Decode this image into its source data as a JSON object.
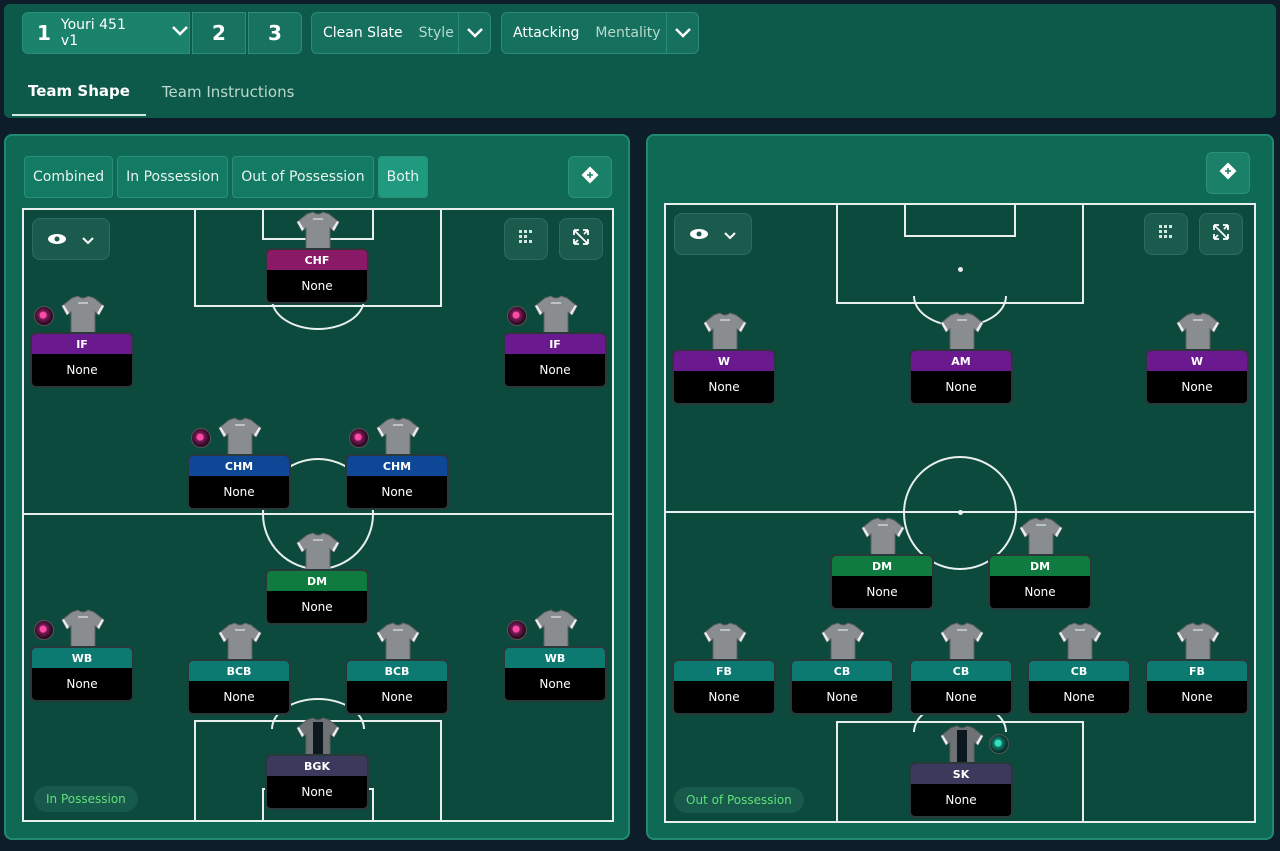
{
  "tactics": {
    "slot1": "1",
    "slot1_name": "Youri 451 v1",
    "slot2": "2",
    "slot3": "3",
    "style_value": "Clean Slate",
    "style_label": "Style",
    "mentality_value": "Attacking",
    "mentality_label": "Mentality"
  },
  "tabs": [
    "Team Shape",
    "Team Instructions"
  ],
  "left": {
    "views": [
      "Combined",
      "In Possession",
      "Out of Possession",
      "Both"
    ],
    "phase_label": "In Possession",
    "players": [
      {
        "role": "CHF",
        "duty": "None",
        "color": "#8a1a68"
      },
      {
        "role": "IF",
        "duty": "None",
        "color": "#6a1a8e"
      },
      {
        "role": "IF",
        "duty": "None",
        "color": "#6a1a8e"
      },
      {
        "role": "CHM",
        "duty": "None",
        "color": "#0e4796"
      },
      {
        "role": "CHM",
        "duty": "None",
        "color": "#0e4796"
      },
      {
        "role": "DM",
        "duty": "None",
        "color": "#0f7b3e"
      },
      {
        "role": "WB",
        "duty": "None",
        "color": "#0d7a72"
      },
      {
        "role": "BCB",
        "duty": "None",
        "color": "#0d7a72"
      },
      {
        "role": "BCB",
        "duty": "None",
        "color": "#0d7a72"
      },
      {
        "role": "WB",
        "duty": "None",
        "color": "#0d7a72"
      },
      {
        "role": "BGK",
        "duty": "None",
        "color": "#3b3a5c"
      }
    ]
  },
  "right": {
    "phase_label": "Out of Possession",
    "players": [
      {
        "role": "W",
        "duty": "None",
        "color": "#6a1a8e"
      },
      {
        "role": "AM",
        "duty": "None",
        "color": "#6a1a8e"
      },
      {
        "role": "W",
        "duty": "None",
        "color": "#6a1a8e"
      },
      {
        "role": "DM",
        "duty": "None",
        "color": "#0f7b3e"
      },
      {
        "role": "DM",
        "duty": "None",
        "color": "#0f7b3e"
      },
      {
        "role": "FB",
        "duty": "None",
        "color": "#0d7a72"
      },
      {
        "role": "CB",
        "duty": "None",
        "color": "#0d7a72"
      },
      {
        "role": "CB",
        "duty": "None",
        "color": "#0d7a72"
      },
      {
        "role": "CB",
        "duty": "None",
        "color": "#0d7a72"
      },
      {
        "role": "FB",
        "duty": "None",
        "color": "#0d7a72"
      },
      {
        "role": "SK",
        "duty": "None",
        "color": "#3b3a5c"
      }
    ]
  }
}
